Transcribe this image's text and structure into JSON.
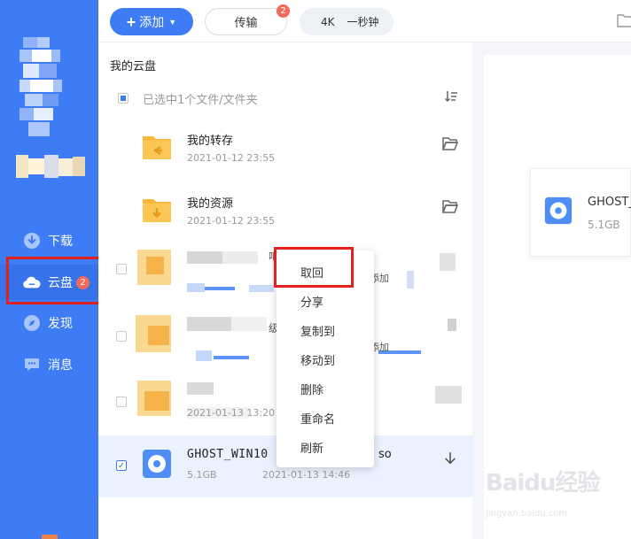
{
  "topbar": {
    "add_label": "添加",
    "add_plus": "+",
    "add_caret": "▼",
    "transfer_label": "传输",
    "transfer_badge": "2",
    "promo_left": "4K",
    "promo_right": "一秒钟"
  },
  "sidebar": {
    "items": [
      {
        "label": "下载",
        "icon": "download-icon"
      },
      {
        "label": "云盘",
        "icon": "cloud-icon",
        "badge": "2",
        "active": true
      },
      {
        "label": "发现",
        "icon": "compass-icon"
      },
      {
        "label": "消息",
        "icon": "message-icon"
      }
    ]
  },
  "list": {
    "breadcrumb": "我的云盘",
    "select_summary": "已选中1个文件/文件夹",
    "rows": [
      {
        "name": "我的转存",
        "date": "2021-01-12 23:55",
        "icon": "folder-transfer-icon"
      },
      {
        "name": "我的资源",
        "date": "2021-01-12 23:55",
        "icon": "folder-download-icon"
      },
      {
        "fragment": "吧"
      },
      {
        "fragment": "级"
      },
      {
        "date_fragment": "2021-01-13 13:20"
      },
      {
        "name": "GHOST_WIN10",
        "name_tail": "so",
        "size": "5.1GB",
        "date": "2021-01-13 14:46",
        "icon": "disc-image-icon"
      }
    ],
    "fragments": {
      "add_1": "添加",
      "add_2": "添加"
    }
  },
  "context_menu": {
    "items": [
      "取回",
      "分享",
      "复制到",
      "移动到",
      "删除",
      "重命名",
      "刷新"
    ]
  },
  "detail": {
    "name": "GHOST_",
    "size": "5.1GB"
  },
  "watermark": {
    "text": "Baidu经验",
    "url": "jingyan.baidu.com"
  },
  "colors": {
    "primary": "#3d7cf4",
    "folder": "#f8b73e",
    "highlight_box": "#e3201b",
    "badge": "#f26a5a"
  }
}
